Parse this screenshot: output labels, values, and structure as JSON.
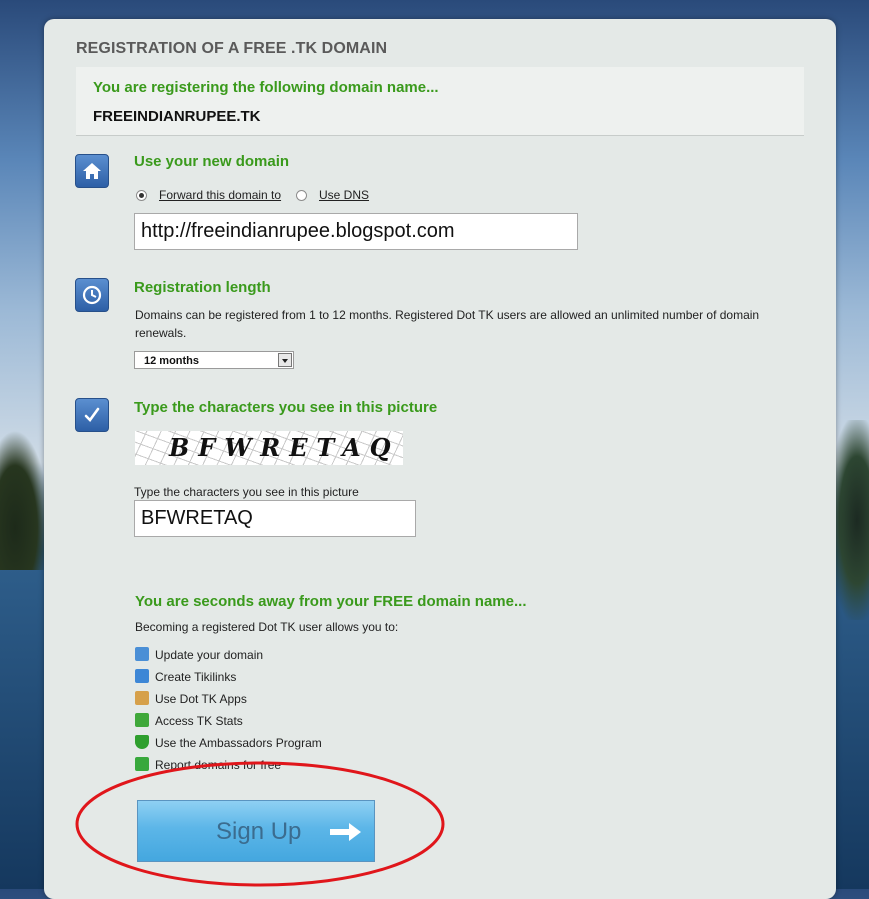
{
  "page": {
    "title": "REGISTRATION OF A FREE .TK DOMAIN",
    "prompt": "You are registering the following domain name...",
    "domain_name": "FREEINDIANRUPEE.TK"
  },
  "use_domain": {
    "title": "Use your new domain",
    "icon": "home-icon",
    "options": [
      {
        "label": "Forward this domain to",
        "selected": true
      },
      {
        "label": "Use DNS",
        "selected": false
      }
    ],
    "forward_url": "http://freeindianrupee.blogspot.com"
  },
  "registration_length": {
    "title": "Registration length",
    "icon": "clock-icon",
    "description": "Domains can be registered from 1 to 12 months. Registered Dot TK users are allowed an unlimited number of domain renewals.",
    "selected": "12 months"
  },
  "captcha": {
    "title": "Type the characters you see in this picture",
    "icon": "checkmark-icon",
    "image_text": "BFWRETAQ",
    "field_label": "Type the characters you see in this picture",
    "value": "BFWRETAQ"
  },
  "benefits": {
    "title": "You are seconds away from your FREE domain name...",
    "intro": "Becoming a registered Dot TK user allows you to:",
    "items": [
      {
        "label": "Update your domain",
        "icon": "refresh-icon",
        "color": "#4a8fd6"
      },
      {
        "label": "Create Tikilinks",
        "icon": "arrow-link-icon",
        "color": "#3d87d6"
      },
      {
        "label": "Use Dot TK Apps",
        "icon": "package-icon",
        "color": "#d6a04a"
      },
      {
        "label": "Access TK Stats",
        "icon": "chart-icon",
        "color": "#3fa83a"
      },
      {
        "label": "Use the Ambassadors Program",
        "icon": "shield-check-icon",
        "color": "#2e9f2e"
      },
      {
        "label": "Report domains for free",
        "icon": "plus-icon",
        "color": "#38a83c"
      }
    ]
  },
  "signup": {
    "label": "Sign Up",
    "icon": "arrow-right-icon"
  },
  "colors": {
    "accent_green": "#3a9a1c",
    "icon_blue": "#2d5fa6",
    "button_blue": "#5cb6e8",
    "annotation_red": "#e0161b"
  }
}
